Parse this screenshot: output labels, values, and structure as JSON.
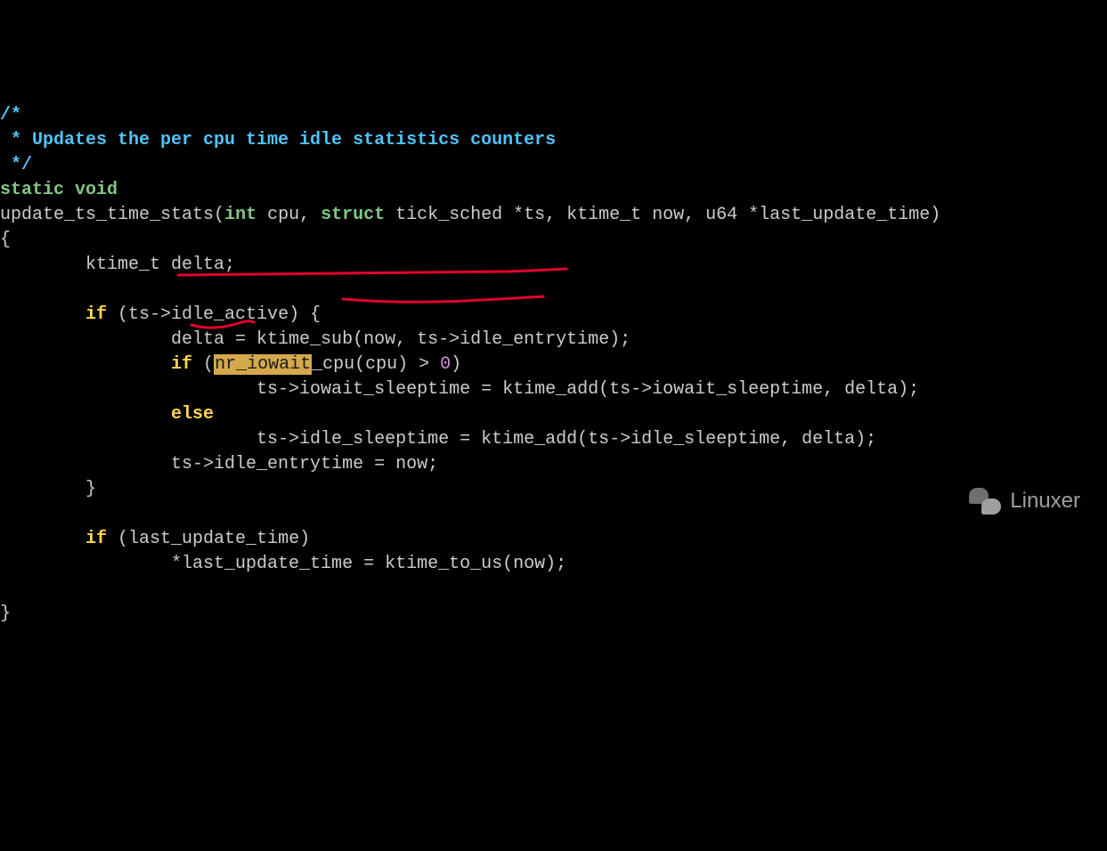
{
  "comment": {
    "open": "/*",
    "line": " * Updates the per cpu time idle statistics counters",
    "close": " */"
  },
  "kw": {
    "static": "static",
    "void": "void",
    "int": "int",
    "struct": "struct",
    "if": "if",
    "else": "else"
  },
  "fn": "update_ts_time_stats",
  "sig": {
    "p1": " cpu, ",
    "p2": " tick_sched *ts, ktime_t now, u64 *last_update_time)"
  },
  "ln": {
    "brace_open": "{",
    "decl": "        ktime_t delta;",
    "blank": "",
    "if1_pre": "        ",
    "if1_cond": " (ts->idle_active) {",
    "assign1": "                delta = ktime_sub(now, ts->idle_entrytime);",
    "if2_pre": "                ",
    "if2_open": " (",
    "if2_hl": "nr_iowait",
    "if2_mid": "_cpu(cpu) > ",
    "if2_zero": "0",
    "if2_close": ")",
    "iowait": "                        ts->iowait_sleeptime = ktime_add(ts->iowait_sleeptime, delta);",
    "else_pre": "                ",
    "idle": "                        ts->idle_sleeptime = ktime_add(ts->idle_sleeptime, delta);",
    "entry": "                ts->idle_entrytime = now;",
    "brace_mid": "        }",
    "if3_pre": "        ",
    "if3_cond": " (last_update_time)",
    "last": "                *last_update_time = ktime_to_us(now);",
    "brace_close": "}"
  },
  "watermark": "Linuxer"
}
